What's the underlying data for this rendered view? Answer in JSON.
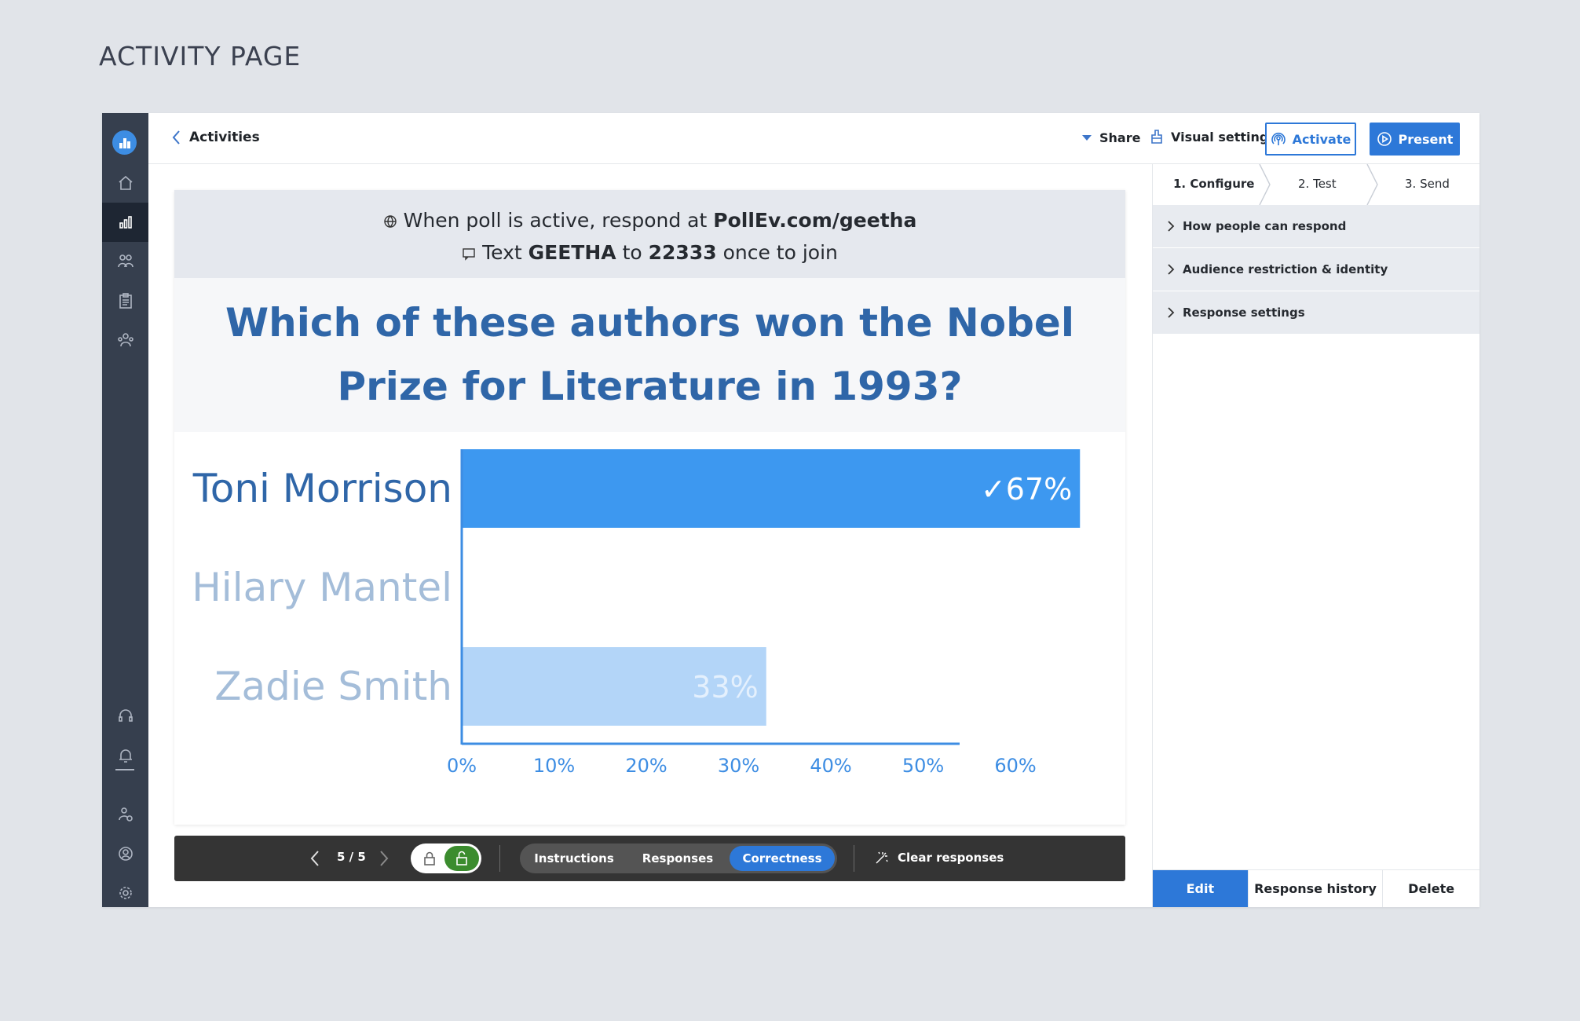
{
  "page_label": "ACTIVITY PAGE",
  "sidebar": {
    "icons": [
      "logo-icon",
      "home-icon",
      "activities-icon",
      "participants-icon",
      "reports-icon",
      "groups-icon",
      "support-icon",
      "notifications-icon",
      "invite-user-icon",
      "account-icon",
      "settings-icon"
    ],
    "active": "activities-icon",
    "colors": {
      "background": "#363f4e",
      "active": "#1e2633",
      "logo": "#3d8de3"
    }
  },
  "topbar": {
    "back_label": "Activities",
    "share_label": "Share",
    "visual_settings_label": "Visual settings",
    "activate_label": "Activate",
    "present_label": "Present"
  },
  "slide": {
    "respond_prefix": "When poll is active, respond at",
    "respond_url": "PollEv.com/geetha",
    "text_prefix": "Text",
    "text_code": "GEETHA",
    "text_mid": "to",
    "text_number": "22333",
    "text_suffix": "once to join",
    "question": "Which of these authors won the Nobel Prize for Literature in 1993?"
  },
  "chart_data": {
    "type": "bar",
    "orientation": "horizontal",
    "categories": [
      "Toni Morrison",
      "Hilary Mantel",
      "Zadie Smith"
    ],
    "values": [
      67,
      0,
      33
    ],
    "value_labels": [
      "✓67%",
      "",
      "33%"
    ],
    "correct": [
      true,
      false,
      false
    ],
    "xlim": [
      0,
      67
    ],
    "xticks": [
      "0%",
      "10%",
      "20%",
      "30%",
      "40%",
      "50%",
      "60%"
    ],
    "grid": false,
    "colors": {
      "correct_bar": "#3d98f0",
      "other_bar": "#b3d5f8",
      "correct_label": "#2f66a8",
      "other_label": "#a4bdd9",
      "axis": "#3d8de3"
    }
  },
  "controls": {
    "page_indicator": "5 / 5",
    "lock_state": "unlocked",
    "segments": [
      "Instructions",
      "Responses",
      "Correctness"
    ],
    "selected_segment": "Correctness",
    "clear_label": "Clear responses"
  },
  "panel": {
    "steps": [
      "1. Configure",
      "2. Test",
      "3. Send"
    ],
    "current_step": "1. Configure",
    "sections": [
      "How people can respond",
      "Audience restriction & identity",
      "Response settings"
    ],
    "footer": {
      "edit_label": "Edit",
      "history_label": "Response history",
      "delete_label": "Delete"
    }
  },
  "accent_color": "#2d78d8"
}
